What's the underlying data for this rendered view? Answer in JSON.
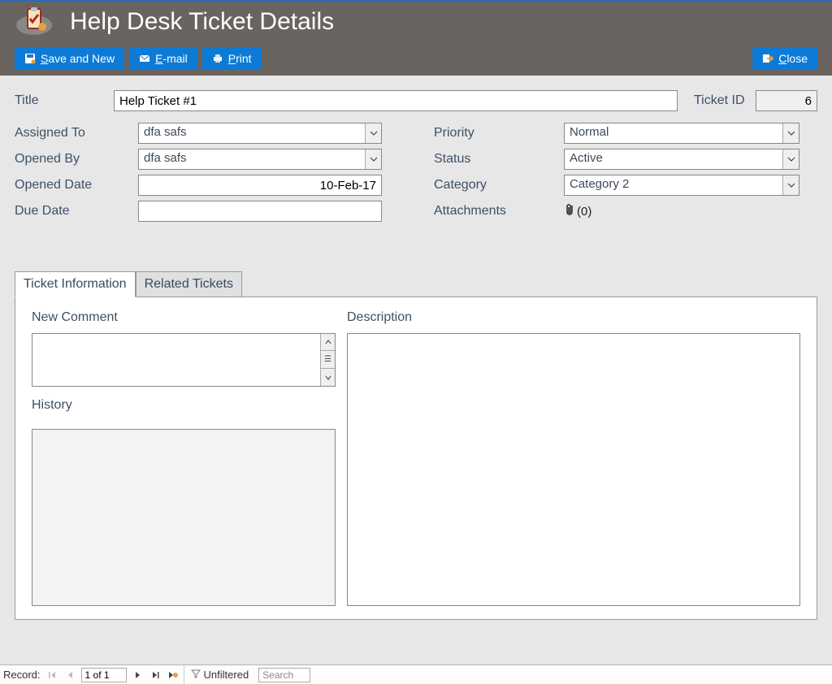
{
  "header": {
    "title": "Help Desk Ticket Details",
    "buttons": {
      "save_and_new": "Save and New",
      "save_hotkey": "S",
      "email": "E-mail",
      "email_hotkey": "E",
      "print": "Print",
      "print_hotkey": "P",
      "close": "Close",
      "close_hotkey": "C"
    }
  },
  "form": {
    "title_label": "Title",
    "title_value": "Help Ticket #1",
    "ticket_id_label": "Ticket ID",
    "ticket_id_value": "6",
    "assigned_to_label": "Assigned To",
    "assigned_to_value": "dfa safs",
    "opened_by_label": "Opened By",
    "opened_by_value": "dfa safs",
    "opened_date_label": "Opened Date",
    "opened_date_value": "10-Feb-17",
    "due_date_label": "Due Date",
    "due_date_value": "",
    "priority_label": "Priority",
    "priority_value": "Normal",
    "status_label": "Status",
    "status_value": "Active",
    "category_label": "Category",
    "category_value": "Category 2",
    "attachments_label": "Attachments",
    "attachments_count": "(0)"
  },
  "tabs": {
    "ticket_info": "Ticket Information",
    "related": "Related Tickets",
    "new_comment_label": "New Comment",
    "history_label": "History",
    "description_label": "Description"
  },
  "recordbar": {
    "label": "Record:",
    "position": "1 of 1",
    "filter_label": "Unfiltered",
    "search_placeholder": "Search"
  }
}
